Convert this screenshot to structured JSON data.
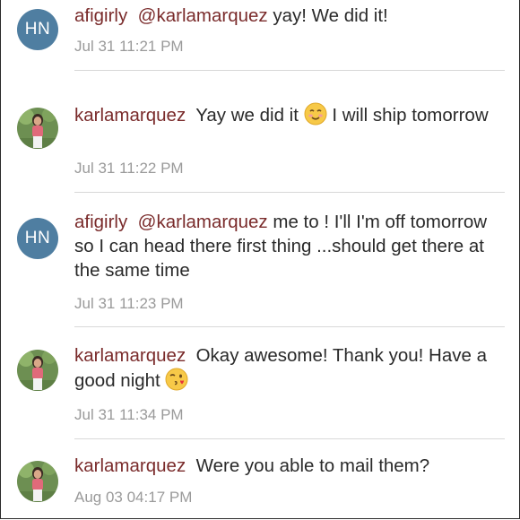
{
  "comments": [
    {
      "avatar_initials": "HN",
      "username": "afigirly",
      "mention": "@karlamarquez",
      "text": "yay! We did it!",
      "timestamp": "Jul 31 11:21 PM"
    },
    {
      "avatar_initials": "",
      "username": "karlamarquez",
      "mention": "",
      "text_before_emoji": "Yay we did it",
      "emoji": "smiling-face-emoji",
      "text_after_emoji": "I will ship tomorrow",
      "timestamp": "Jul 31 11:22 PM"
    },
    {
      "avatar_initials": "HN",
      "username": "afigirly",
      "mention": "@karlamarquez",
      "text": "me to ! I'll I'm off tomorrow so I can head there first thing ...should get there at the same time",
      "timestamp": "Jul 31 11:23 PM"
    },
    {
      "avatar_initials": "",
      "username": "karlamarquez",
      "mention": "",
      "text_before_emoji": "Okay awesome! Thank you! Have a good night",
      "emoji": "face-blowing-kiss-emoji",
      "text_after_emoji": "",
      "timestamp": "Jul 31 11:34 PM"
    },
    {
      "avatar_initials": "",
      "username": "karlamarquez",
      "mention": "",
      "text": "Were you able to mail them?",
      "timestamp": "Aug 03 04:17 PM"
    }
  ],
  "colors": {
    "username": "#7a2b2b",
    "text": "#2a2a2a",
    "timestamp": "#9a9a9a",
    "avatar_bg": "#4f7ea1",
    "divider": "#d8d8d8"
  }
}
